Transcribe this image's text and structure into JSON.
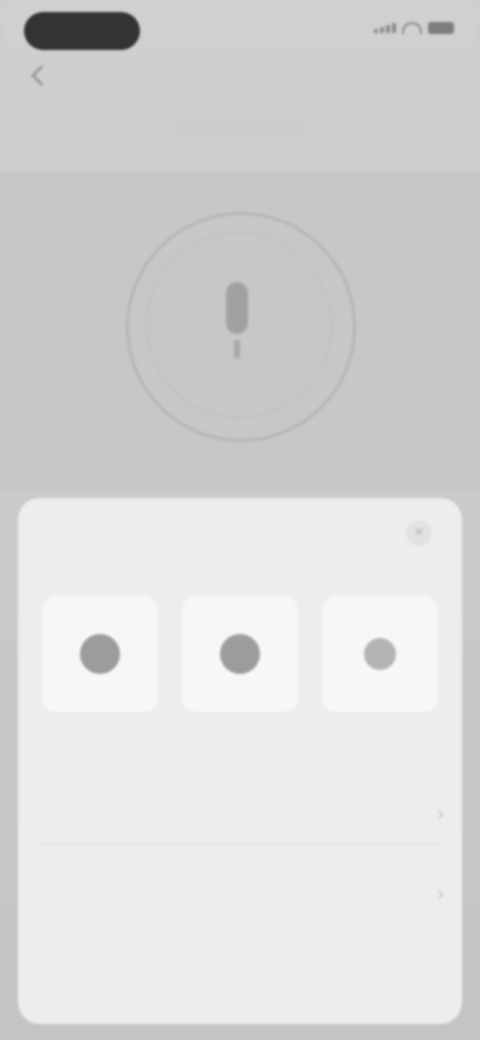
{
  "status_bar": {
    "time": ""
  },
  "nav": {
    "title": ""
  },
  "tabs": [
    {
      "label": ""
    },
    {
      "label": ""
    },
    {
      "label": ""
    }
  ],
  "hero": {
    "value": ""
  },
  "sheet": {
    "title": "",
    "close_icon": "close-icon",
    "options": [
      {
        "label": "",
        "icon": "option-icon"
      },
      {
        "label": "",
        "icon": "option-icon"
      },
      {
        "label": "",
        "icon": "option-icon"
      }
    ],
    "rows": [
      {
        "label": "",
        "icon": "chevron-right-icon"
      },
      {
        "label": "",
        "icon": "chevron-right-icon"
      }
    ]
  }
}
